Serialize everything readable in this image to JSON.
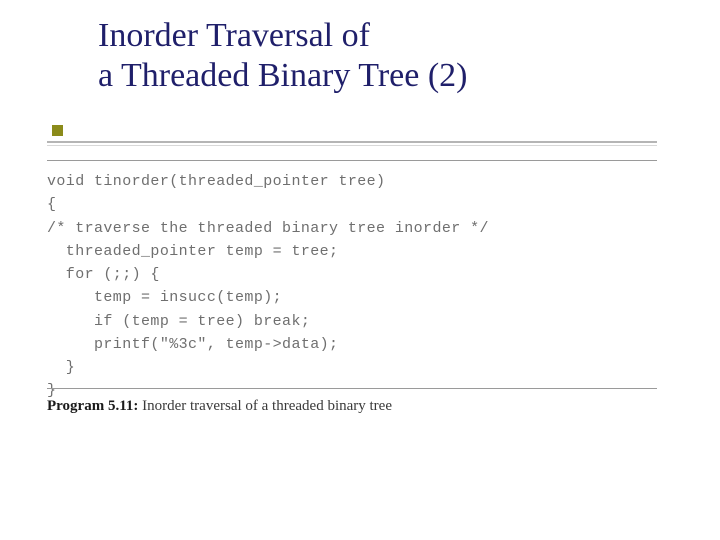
{
  "title": {
    "line1": "Inorder Traversal of",
    "line2": " a Threaded Binary Tree (2)"
  },
  "code": {
    "l1": "void tinorder(threaded_pointer tree)",
    "l2": "{",
    "l3": "/* traverse the threaded binary tree inorder */",
    "l4": "  threaded_pointer temp = tree;",
    "l5": "  for (;;) {",
    "l6": "     temp = insucc(temp);",
    "l7": "     if (temp = tree) break;",
    "l8": "     printf(\"%3c\", temp->data);",
    "l9": "  }",
    "l10": "}"
  },
  "caption": {
    "label": "Program 5.11:",
    "text": " Inorder traversal of a threaded binary tree"
  }
}
